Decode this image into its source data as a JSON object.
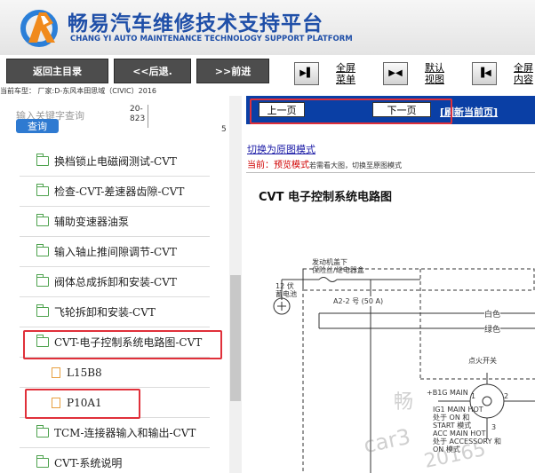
{
  "header": {
    "title_cn": "畅易汽车维修技术支持平台",
    "title_en": "CHANG YI AUTO MAINTENANCE TECHNOLOGY SUPPORT PLATFORM"
  },
  "toolbar": {
    "home_label": "返回主目录",
    "back_label": "<<后退.",
    "forward_label": ">>前进",
    "fullscreen_menu_line1": "全屏",
    "fullscreen_menu_line2": "菜单",
    "default_view_line1": "默认",
    "default_view_line2": "视图",
    "fullscreen_content_line1": "全屏",
    "fullscreen_content_line2": "内容",
    "car_info": "当前车型：  厂家:D-东风本田思域（CIVIC）2016"
  },
  "left_panel": {
    "search_placeholder": "输入关键字查询",
    "search_button": "查询",
    "count_line1": "20-",
    "count_line2": "823",
    "page_number": "5",
    "tree_items": [
      {
        "label": "换档锁止电磁阀测试-CVT",
        "type": "folder"
      },
      {
        "label": "检查-CVT-差速器齿隙-CVT",
        "type": "folder"
      },
      {
        "label": "辅助变速器油泵",
        "type": "folder"
      },
      {
        "label": "输入轴止推间隙调节-CVT",
        "type": "folder"
      },
      {
        "label": "阀体总成拆卸和安装-CVT",
        "type": "folder"
      },
      {
        "label": "飞轮拆卸和安装-CVT",
        "type": "folder"
      },
      {
        "label": "CVT-电子控制系统电路图-CVT",
        "type": "folder-open"
      },
      {
        "label": "L15B8",
        "type": "file"
      },
      {
        "label": "P10A1",
        "type": "file"
      },
      {
        "label": "TCM-连接器输入和输出-CVT",
        "type": "folder"
      },
      {
        "label": "CVT-系统说明",
        "type": "folder"
      }
    ]
  },
  "right_panel": {
    "prev_page": "上一页",
    "next_page": "下一页",
    "refresh": "[刷新当前页]",
    "switch_link": "切换为原图模式",
    "mode_current": "当前：",
    "mode_name": "预览模式",
    "mode_hint": "若需看大图，切换至原图模式",
    "diagram_title": "CVT 电子控制系统电路图",
    "diagram_labels": {
      "engine_room": "发动机盖下",
      "fuse_box": "保险丝/继电器盒",
      "battery_line1": "12 伏",
      "battery_line2": "蓄电池",
      "fuse": "A2-2 号 (50 A)",
      "white": "白色",
      "green": "绿色",
      "ignition": "点火开关",
      "big_main": "+B1G MAIN",
      "ig1_line1": "IG1 MAIN HOT",
      "ig1_line2": "处于 ON 和",
      "ig1_line3": "START 模式",
      "acc_line1": "ACC MAIN HOT",
      "acc_line2": "处于 ACCESSORY 和",
      "acc_line3": "ON 模式",
      "pin1": "1",
      "pin2": "2",
      "pin3": "3",
      "watermark1": "畅",
      "watermark2": "car3",
      "watermark3": "20165"
    }
  },
  "colors": {
    "brand_blue": "#1f4fa8",
    "toolbar_button": "#4d4d4d",
    "nav_bar": "#0a3fa5",
    "highlight_red": "#e0303a",
    "folder_green": "#4ea24e",
    "file_orange": "#e8a040"
  }
}
